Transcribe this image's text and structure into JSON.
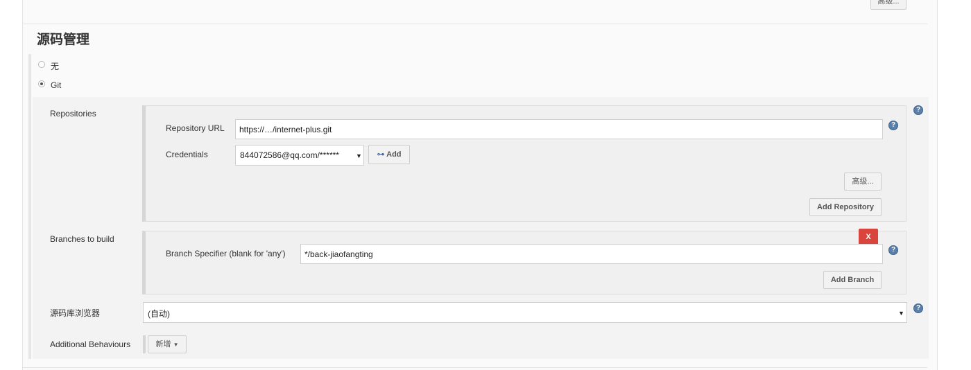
{
  "top_advanced_button": "高级...",
  "section_title": "源码管理",
  "scm_options": [
    {
      "label": "无",
      "selected": false
    },
    {
      "label": "Git",
      "selected": true
    }
  ],
  "repositories": {
    "label": "Repositories",
    "url_label": "Repository URL",
    "url_value": "https://…/internet-plus.git",
    "credentials_label": "Credentials",
    "credentials_value": "844072586@qq.com/******",
    "add_label": "Add",
    "advanced_label": "高级...",
    "add_repository_label": "Add Repository"
  },
  "branches": {
    "label": "Branches to build",
    "delete_label": "X",
    "specifier_label": "Branch Specifier (blank for 'any')",
    "specifier_value": "*/back-jiaofangting",
    "add_branch_label": "Add Branch"
  },
  "repo_browser": {
    "label": "源码库浏览器",
    "value": "(自动)"
  },
  "additional_behaviours": {
    "label": "Additional Behaviours",
    "add_label": "新增"
  },
  "help_icon_glyph": "?",
  "colors": {
    "panel_bg": "#fafafa",
    "box_bg": "#f0f0f0",
    "help_icon": "#5a7fa8",
    "delete_red": "#d9453d"
  }
}
